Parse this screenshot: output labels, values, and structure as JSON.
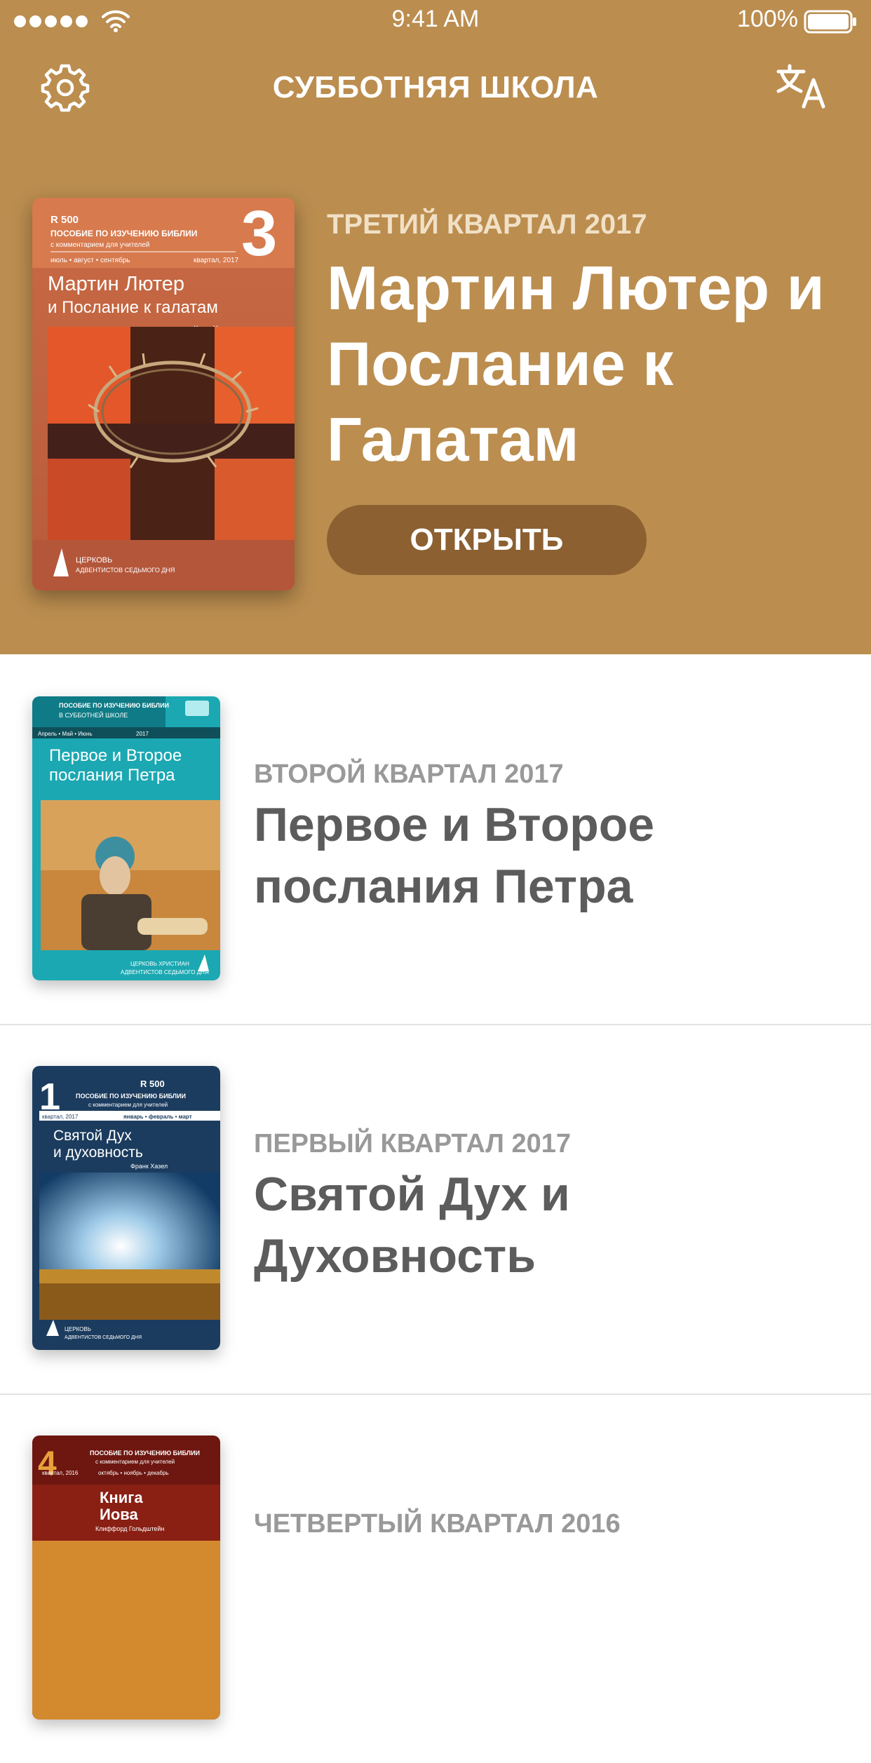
{
  "status_bar": {
    "time": "9:41 AM",
    "battery": "100%"
  },
  "header": {
    "title": "СУББОТНЯЯ ШКОЛА",
    "settings_icon": "gear-icon",
    "translate_icon": "translate-icon"
  },
  "featured": {
    "quarter": "ТРЕТИЙ КВАРТАЛ 2017",
    "title": "Мартин Лютер и Послание к Галатам",
    "button": "ОТКРЫТЬ",
    "cover": {
      "number": "3",
      "top_text": "ПОСОБИЕ ПО ИЗУЧЕНИЮ БИБЛИИ",
      "top_sub": "с комментарием для учителей",
      "months": "июль • август • сентябрь",
      "year": "квартал, 2017",
      "title_line1": "Мартин Лютер",
      "title_line2": "и Послание к галатам",
      "author": "Карл Хасерт",
      "footer_line1": "ЦЕРКОВЬ",
      "footer_line2": "АДВЕНТИСТОВ СЕДЬМОГО ДНЯ"
    }
  },
  "quarterlies": [
    {
      "quarter": "ВТОРОЙ КВАРТАЛ 2017",
      "title": "Первое и Второе послания Петра",
      "cover": {
        "top_text": "ПОСОБИЕ ПО ИЗУЧЕНИЮ БИБЛИИ",
        "top_sub": "В СУББОТНЕЙ ШКОЛЕ",
        "months": "Апрель • Май • Июнь",
        "year": "2017",
        "title_line1": "Первое и Второе",
        "title_line2": "послания Петра",
        "footer_line1": "ЦЕРКОВЬ ХРИСТИАН",
        "footer_line2": "АДВЕНТИСТОВ СЕДЬМОГО ДНЯ"
      }
    },
    {
      "quarter": "ПЕРВЫЙ КВАРТАЛ 2017",
      "title": "Святой Дух и Духовность",
      "cover": {
        "number": "1",
        "top_text": "ПОСОБИЕ ПО ИЗУЧЕНИЮ БИБЛИИ",
        "top_sub": "с комментарием для учителей",
        "months": "январь • февраль • март",
        "year": "квартал, 2017",
        "title_line1": "Святой Дух",
        "title_line2": "и духовность",
        "author": "Франк Хазел",
        "footer_line1": "ЦЕРКОВЬ",
        "footer_line2": "АДВЕНТИСТОВ СЕДЬМОГО ДНЯ"
      }
    },
    {
      "quarter": "ЧЕТВЕРТЫЙ КВАРТАЛ 2016",
      "title": "",
      "cover": {
        "number": "4",
        "top_text": "ПОСОБИЕ ПО ИЗУЧЕНИЮ БИБЛИИ",
        "top_sub": "с комментарием для учителей",
        "months": "октябрь • ноябрь • декабрь",
        "year": "квартал, 2016",
        "title_line1": "Книга",
        "title_line2": "Иова",
        "author": "Клиффорд Гольдштейн"
      }
    }
  ],
  "colors": {
    "hero_background": "#bb8d4f",
    "button_background": "#8c6031",
    "quarter_text": "#999999",
    "title_text": "#5c5c5c"
  }
}
